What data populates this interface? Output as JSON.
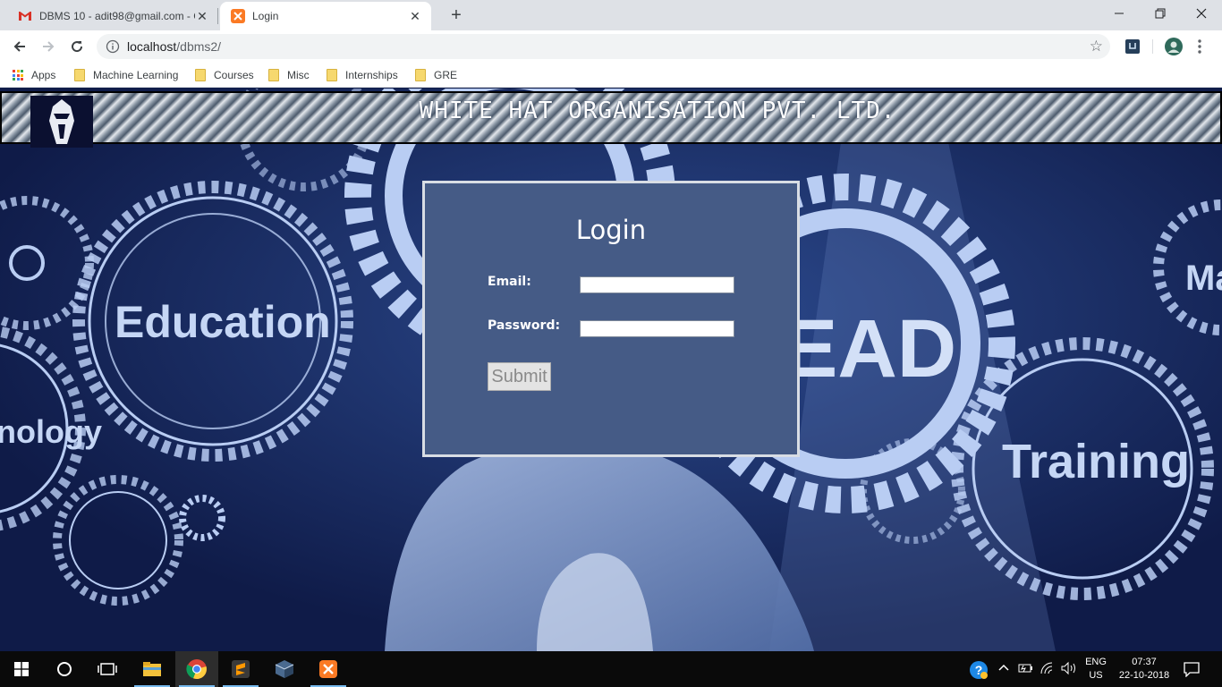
{
  "browser": {
    "tabs": [
      {
        "title": "DBMS 10 - adit98@gmail.com - G",
        "favicon": "gmail-icon",
        "active": false
      },
      {
        "title": "Login",
        "favicon": "xampp-icon",
        "active": true
      }
    ],
    "address": {
      "host": "localhost",
      "path": "/dbms2/"
    },
    "bookmarks": [
      {
        "label": "Apps",
        "icon": "apps-grid-icon"
      },
      {
        "label": "Machine Learning",
        "icon": "folder-icon"
      },
      {
        "label": "Courses",
        "icon": "folder-icon"
      },
      {
        "label": "Misc",
        "icon": "folder-icon"
      },
      {
        "label": "Internships",
        "icon": "folder-icon"
      },
      {
        "label": "GRE",
        "icon": "folder-icon"
      }
    ]
  },
  "page": {
    "org_title": "WHITE HAT ORGANISATION PVT. LTD.",
    "background_words": [
      "Education",
      "nology",
      "EAD",
      "Training",
      "Ma"
    ],
    "login": {
      "title": "Login",
      "email_label": "Email:",
      "email_value": "",
      "password_label": "Password:",
      "password_value": "",
      "submit_label": "Submit"
    }
  },
  "taskbar": {
    "apps": [
      "start-icon",
      "cortana-icon",
      "task-view-icon",
      "file-explorer-icon",
      "chrome-icon",
      "sublime-text-icon",
      "app-cube-icon",
      "xampp-icon"
    ],
    "language": {
      "line1": "ENG",
      "line2": "US"
    },
    "time": "07:37",
    "date": "22-10-2018"
  },
  "colors": {
    "card_bg": "#455b86",
    "page_bg": "#122052",
    "gear": "#b9cdf3",
    "tab_strip": "#dee1e6"
  }
}
